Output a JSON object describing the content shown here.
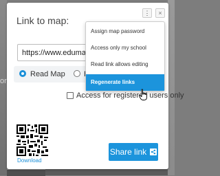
{
  "background": {
    "left_text": "ord,"
  },
  "modal": {
    "title": "Link to map:",
    "link_hint": "k",
    "url_value": "https://www.edumaps.c",
    "radios": [
      {
        "label": "Read Map",
        "checked": true
      },
      {
        "label": "E",
        "checked": false
      }
    ],
    "radio_tail": "a",
    "checkbox_label": "Access for registered users only",
    "checkbox_checked": false,
    "download_label": "Download",
    "share_label": "Share link",
    "kebab_icon": "⋮",
    "close_icon": "×"
  },
  "dropdown": {
    "items": [
      {
        "label": "Assign map password"
      },
      {
        "label": "Access only my school"
      },
      {
        "label": "Read link allows editing"
      },
      {
        "label": "Regenerate links",
        "active": true
      }
    ]
  },
  "colors": {
    "accent": "#1c94dc",
    "link": "#1a8fd8"
  }
}
